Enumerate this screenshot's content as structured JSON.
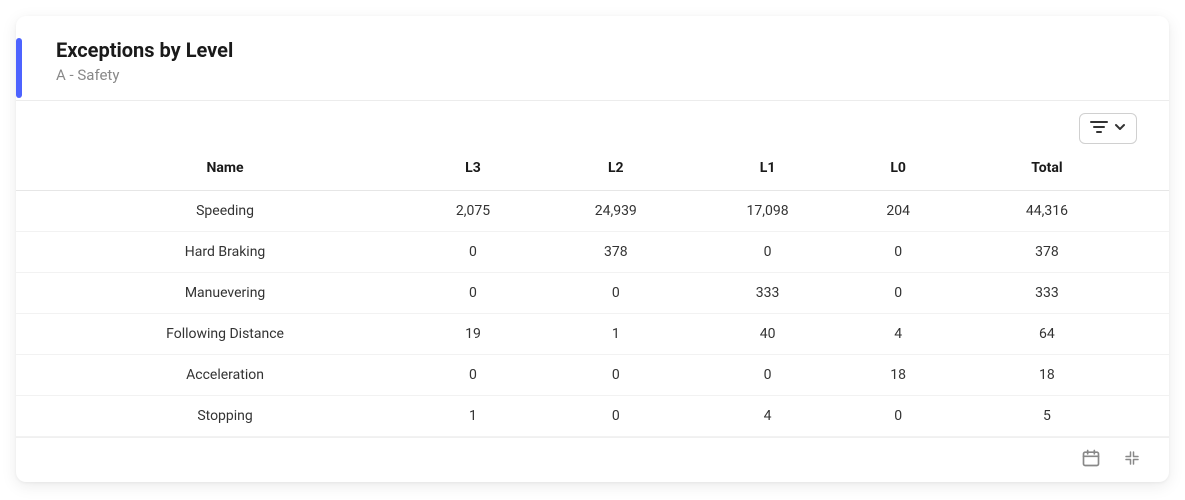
{
  "header": {
    "title": "Exceptions by Level",
    "subtitle": "A - Safety"
  },
  "toolbar": {
    "filter_label": "Filter"
  },
  "table": {
    "columns": [
      "Name",
      "L3",
      "L2",
      "L1",
      "L0",
      "Total"
    ],
    "rows": [
      {
        "name": "Speeding",
        "l3": "2,075",
        "l2": "24,939",
        "l1": "17,098",
        "l0": "204",
        "total": "44,316"
      },
      {
        "name": "Hard Braking",
        "l3": "0",
        "l2": "378",
        "l1": "0",
        "l0": "0",
        "total": "378"
      },
      {
        "name": "Manuevering",
        "l3": "0",
        "l2": "0",
        "l1": "333",
        "l0": "0",
        "total": "333"
      },
      {
        "name": "Following Distance",
        "l3": "19",
        "l2": "1",
        "l1": "40",
        "l0": "4",
        "total": "64"
      },
      {
        "name": "Acceleration",
        "l3": "0",
        "l2": "0",
        "l1": "0",
        "l0": "18",
        "total": "18"
      },
      {
        "name": "Stopping",
        "l3": "1",
        "l2": "0",
        "l1": "4",
        "l0": "0",
        "total": "5"
      }
    ]
  }
}
